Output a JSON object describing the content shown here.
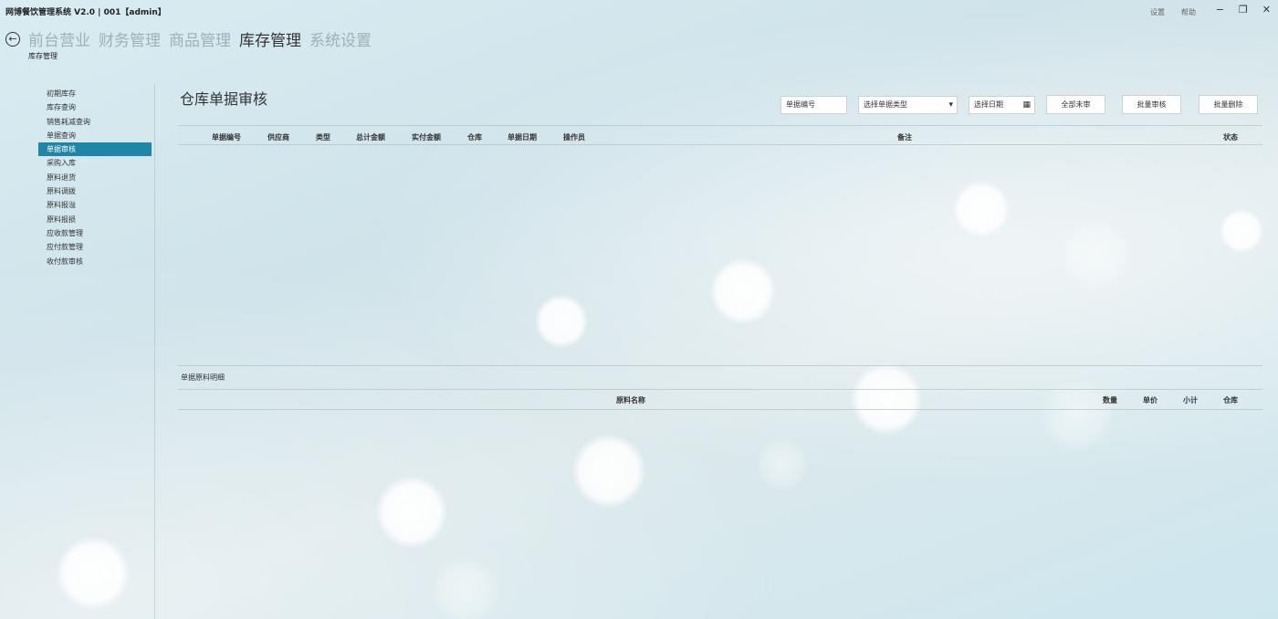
{
  "app": {
    "title": "网博餐饮管理系统 V2.0 | 001【admin】",
    "links": [
      "设置",
      "帮助"
    ],
    "controls": {
      "minimize": "−",
      "restore": "❐",
      "close": "✕"
    }
  },
  "nav": {
    "back_icon": "←",
    "items": [
      {
        "label": "前台营业",
        "active": false
      },
      {
        "label": "财务管理",
        "active": false
      },
      {
        "label": "商品管理",
        "active": false
      },
      {
        "label": "库存管理",
        "active": true
      },
      {
        "label": "系统设置",
        "active": false
      }
    ],
    "breadcrumb": "库存管理"
  },
  "sidebar": {
    "items": [
      {
        "label": "初期库存",
        "active": false
      },
      {
        "label": "库存查询",
        "active": false
      },
      {
        "label": "销售耗减查询",
        "active": false
      },
      {
        "label": "单据查询",
        "active": false
      },
      {
        "label": "单据审核",
        "active": true
      },
      {
        "label": "采购入库",
        "active": false
      },
      {
        "label": "原料退货",
        "active": false
      },
      {
        "label": "原料调拨",
        "active": false
      },
      {
        "label": "原料报溢",
        "active": false
      },
      {
        "label": "原料报损",
        "active": false
      },
      {
        "label": "应收款管理",
        "active": false
      },
      {
        "label": "应付款管理",
        "active": false
      },
      {
        "label": "收付款审核",
        "active": false
      }
    ]
  },
  "main": {
    "title": "仓库单据审核",
    "filters": {
      "doc_no_placeholder": "单据编号",
      "doc_type_placeholder": "选择单据类型",
      "date_placeholder": "选择日期",
      "dropdown_icon": "▾",
      "calendar_icon": "▦"
    },
    "buttons": {
      "all_unapproved": "全部未审",
      "batch_approve": "批量审核",
      "batch_delete": "批量删除"
    },
    "doc_table": {
      "columns": [
        "单据编号",
        "供应商",
        "类型",
        "总计金额",
        "实付金额",
        "仓库",
        "单据日期",
        "操作员",
        "备注",
        "状态"
      ],
      "rows": []
    },
    "detail": {
      "label": "单据原料明细",
      "columns": [
        "原料名称",
        "数量",
        "单价",
        "小计",
        "仓库"
      ],
      "rows": []
    }
  },
  "colors": {
    "accent": "#1f86a8",
    "nav_inactive": "#9fb0b6",
    "nav_active": "#333333"
  }
}
